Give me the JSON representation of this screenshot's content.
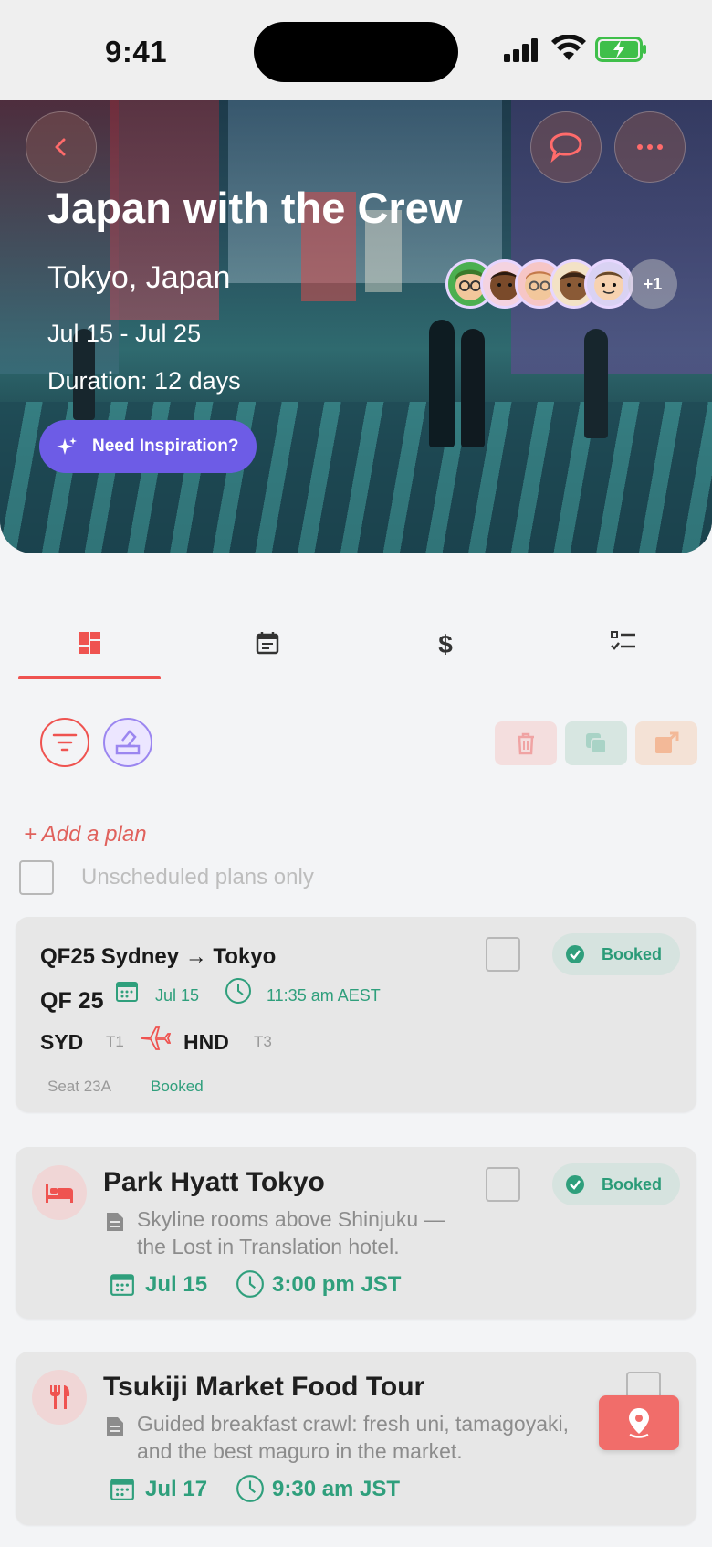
{
  "status_bar": {
    "time": "9:41"
  },
  "hero": {
    "title": "Japan with the Crew",
    "location": "Tokyo, Japan",
    "dates": "Jul 15 - Jul 25",
    "duration": "Duration: 12 days",
    "inspiration_label": "Need Inspiration?",
    "extra_members": "+1"
  },
  "tabs": [
    {
      "icon": "dashboard-icon"
    },
    {
      "icon": "calendar-icon"
    },
    {
      "icon": "dollar-icon"
    },
    {
      "icon": "checklist-icon"
    }
  ],
  "actions": {
    "add_plan": "+ Add a plan",
    "unscheduled_only": "Unscheduled plans only"
  },
  "flight": {
    "title": "QF25 Sydney → Tokyo",
    "code": "QF 25",
    "date": "Jul 15",
    "time": "11:35 am AEST",
    "from": "SYD",
    "from_terminal": "T1",
    "to": "HND",
    "to_terminal": "T3",
    "seat": "Seat 23A",
    "status_text": "Booked",
    "badge": "Booked"
  },
  "plans": [
    {
      "title": "Park Hyatt Tokyo",
      "desc_line1": "Skyline rooms above Shinjuku —",
      "desc_line2": "the Lost in Translation hotel.",
      "date": "Jul 15",
      "time": "3:00 pm JST",
      "badge": "Booked",
      "icon": "bed-icon"
    },
    {
      "title": "Tsukiji Market Food Tour",
      "desc_line1": "Guided breakfast crawl: fresh uni, tamagoyaki,",
      "desc_line2": "and the best maguro in the market.",
      "date": "Jul 17",
      "time": "9:30 am JST",
      "icon": "utensils-icon"
    }
  ],
  "colors": {
    "accent": "#ef5350",
    "green": "#2f9f7c",
    "purple": "#6d5ce6"
  }
}
